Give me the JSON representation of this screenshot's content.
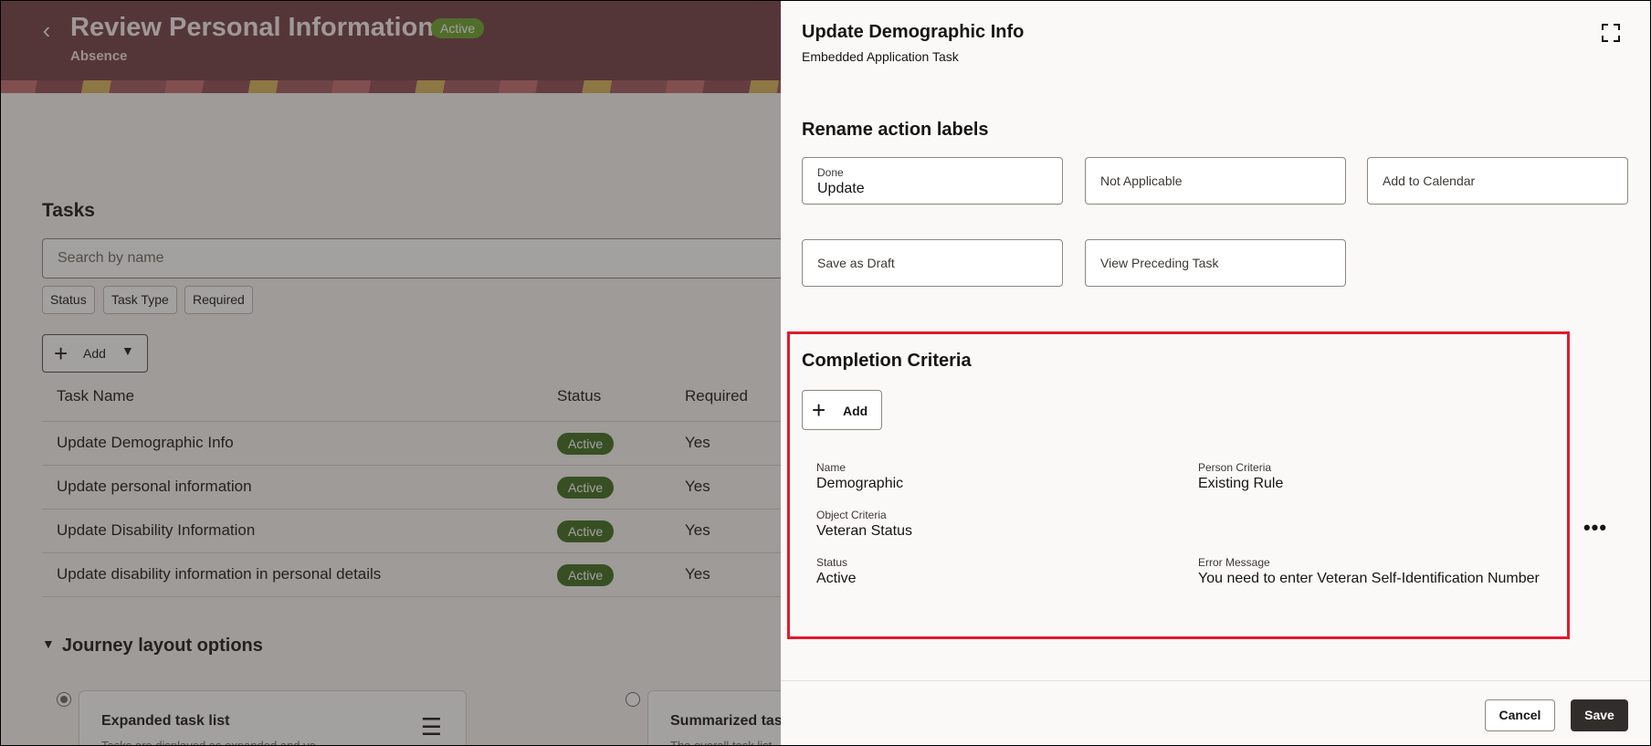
{
  "page": {
    "title": "Review Personal Information",
    "status_badge": "Active",
    "subtitle": "Absence"
  },
  "tasks": {
    "heading": "Tasks",
    "search_placeholder": "Search by name",
    "filters": [
      "Status",
      "Task Type",
      "Required"
    ],
    "add_label": "Add",
    "columns": [
      "Task Name",
      "Status",
      "Required"
    ],
    "rows": [
      {
        "name": "Update Demographic Info",
        "status": "Active",
        "required": "Yes"
      },
      {
        "name": "Update personal information",
        "status": "Active",
        "required": "Yes"
      },
      {
        "name": "Update Disability Information",
        "status": "Active",
        "required": "Yes"
      },
      {
        "name": "Update disability information in personal details",
        "status": "Active",
        "required": "Yes"
      }
    ]
  },
  "journey": {
    "heading": "Journey layout options",
    "options": [
      {
        "title": "Expanded task list",
        "desc": "Tasks are displayed as expanded and ve"
      },
      {
        "title": "Summarized tas",
        "desc": "The overall task list"
      }
    ]
  },
  "drawer": {
    "title": "Update Demographic Info",
    "subtitle": "Embedded Application Task",
    "rename_heading": "Rename action labels",
    "fields": {
      "done_label": "Done",
      "done_value": "Update",
      "not_applicable": "Not Applicable",
      "add_to_calendar": "Add to Calendar",
      "save_as_draft": "Save as Draft",
      "view_preceding": "View Preceding Task"
    },
    "criteria": {
      "heading": "Completion Criteria",
      "add_label": "Add",
      "name_label": "Name",
      "name_value": "Demographic",
      "person_label": "Person Criteria",
      "person_value": "Existing Rule",
      "object_label": "Object Criteria",
      "object_value": "Veteran Status",
      "status_label": "Status",
      "status_value": "Active",
      "error_label": "Error Message",
      "error_value": "You need to enter Veteran Self-Identification Number"
    },
    "cancel_label": "Cancel",
    "save_label": "Save"
  },
  "colors": {
    "header_bg": "#6f3c46",
    "active_badge": "#3d6b1f",
    "highlight_border": "#e11a2d",
    "primary_button": "#312d2a"
  }
}
